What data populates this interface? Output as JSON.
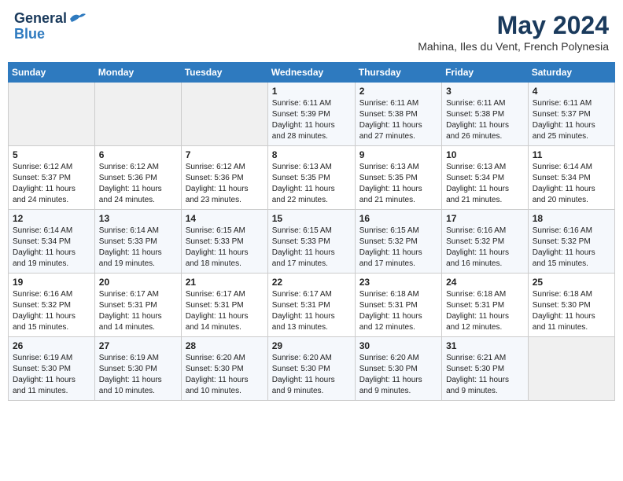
{
  "header": {
    "logo_line1": "General",
    "logo_line2": "Blue",
    "month": "May 2024",
    "location": "Mahina, Iles du Vent, French Polynesia"
  },
  "weekdays": [
    "Sunday",
    "Monday",
    "Tuesday",
    "Wednesday",
    "Thursday",
    "Friday",
    "Saturday"
  ],
  "weeks": [
    [
      {
        "day": "",
        "info": ""
      },
      {
        "day": "",
        "info": ""
      },
      {
        "day": "",
        "info": ""
      },
      {
        "day": "1",
        "info": "Sunrise: 6:11 AM\nSunset: 5:39 PM\nDaylight: 11 hours\nand 28 minutes."
      },
      {
        "day": "2",
        "info": "Sunrise: 6:11 AM\nSunset: 5:38 PM\nDaylight: 11 hours\nand 27 minutes."
      },
      {
        "day": "3",
        "info": "Sunrise: 6:11 AM\nSunset: 5:38 PM\nDaylight: 11 hours\nand 26 minutes."
      },
      {
        "day": "4",
        "info": "Sunrise: 6:11 AM\nSunset: 5:37 PM\nDaylight: 11 hours\nand 25 minutes."
      }
    ],
    [
      {
        "day": "5",
        "info": "Sunrise: 6:12 AM\nSunset: 5:37 PM\nDaylight: 11 hours\nand 24 minutes."
      },
      {
        "day": "6",
        "info": "Sunrise: 6:12 AM\nSunset: 5:36 PM\nDaylight: 11 hours\nand 24 minutes."
      },
      {
        "day": "7",
        "info": "Sunrise: 6:12 AM\nSunset: 5:36 PM\nDaylight: 11 hours\nand 23 minutes."
      },
      {
        "day": "8",
        "info": "Sunrise: 6:13 AM\nSunset: 5:35 PM\nDaylight: 11 hours\nand 22 minutes."
      },
      {
        "day": "9",
        "info": "Sunrise: 6:13 AM\nSunset: 5:35 PM\nDaylight: 11 hours\nand 21 minutes."
      },
      {
        "day": "10",
        "info": "Sunrise: 6:13 AM\nSunset: 5:34 PM\nDaylight: 11 hours\nand 21 minutes."
      },
      {
        "day": "11",
        "info": "Sunrise: 6:14 AM\nSunset: 5:34 PM\nDaylight: 11 hours\nand 20 minutes."
      }
    ],
    [
      {
        "day": "12",
        "info": "Sunrise: 6:14 AM\nSunset: 5:34 PM\nDaylight: 11 hours\nand 19 minutes."
      },
      {
        "day": "13",
        "info": "Sunrise: 6:14 AM\nSunset: 5:33 PM\nDaylight: 11 hours\nand 19 minutes."
      },
      {
        "day": "14",
        "info": "Sunrise: 6:15 AM\nSunset: 5:33 PM\nDaylight: 11 hours\nand 18 minutes."
      },
      {
        "day": "15",
        "info": "Sunrise: 6:15 AM\nSunset: 5:33 PM\nDaylight: 11 hours\nand 17 minutes."
      },
      {
        "day": "16",
        "info": "Sunrise: 6:15 AM\nSunset: 5:32 PM\nDaylight: 11 hours\nand 17 minutes."
      },
      {
        "day": "17",
        "info": "Sunrise: 6:16 AM\nSunset: 5:32 PM\nDaylight: 11 hours\nand 16 minutes."
      },
      {
        "day": "18",
        "info": "Sunrise: 6:16 AM\nSunset: 5:32 PM\nDaylight: 11 hours\nand 15 minutes."
      }
    ],
    [
      {
        "day": "19",
        "info": "Sunrise: 6:16 AM\nSunset: 5:32 PM\nDaylight: 11 hours\nand 15 minutes."
      },
      {
        "day": "20",
        "info": "Sunrise: 6:17 AM\nSunset: 5:31 PM\nDaylight: 11 hours\nand 14 minutes."
      },
      {
        "day": "21",
        "info": "Sunrise: 6:17 AM\nSunset: 5:31 PM\nDaylight: 11 hours\nand 14 minutes."
      },
      {
        "day": "22",
        "info": "Sunrise: 6:17 AM\nSunset: 5:31 PM\nDaylight: 11 hours\nand 13 minutes."
      },
      {
        "day": "23",
        "info": "Sunrise: 6:18 AM\nSunset: 5:31 PM\nDaylight: 11 hours\nand 12 minutes."
      },
      {
        "day": "24",
        "info": "Sunrise: 6:18 AM\nSunset: 5:31 PM\nDaylight: 11 hours\nand 12 minutes."
      },
      {
        "day": "25",
        "info": "Sunrise: 6:18 AM\nSunset: 5:30 PM\nDaylight: 11 hours\nand 11 minutes."
      }
    ],
    [
      {
        "day": "26",
        "info": "Sunrise: 6:19 AM\nSunset: 5:30 PM\nDaylight: 11 hours\nand 11 minutes."
      },
      {
        "day": "27",
        "info": "Sunrise: 6:19 AM\nSunset: 5:30 PM\nDaylight: 11 hours\nand 10 minutes."
      },
      {
        "day": "28",
        "info": "Sunrise: 6:20 AM\nSunset: 5:30 PM\nDaylight: 11 hours\nand 10 minutes."
      },
      {
        "day": "29",
        "info": "Sunrise: 6:20 AM\nSunset: 5:30 PM\nDaylight: 11 hours\nand 9 minutes."
      },
      {
        "day": "30",
        "info": "Sunrise: 6:20 AM\nSunset: 5:30 PM\nDaylight: 11 hours\nand 9 minutes."
      },
      {
        "day": "31",
        "info": "Sunrise: 6:21 AM\nSunset: 5:30 PM\nDaylight: 11 hours\nand 9 minutes."
      },
      {
        "day": "",
        "info": ""
      }
    ]
  ]
}
